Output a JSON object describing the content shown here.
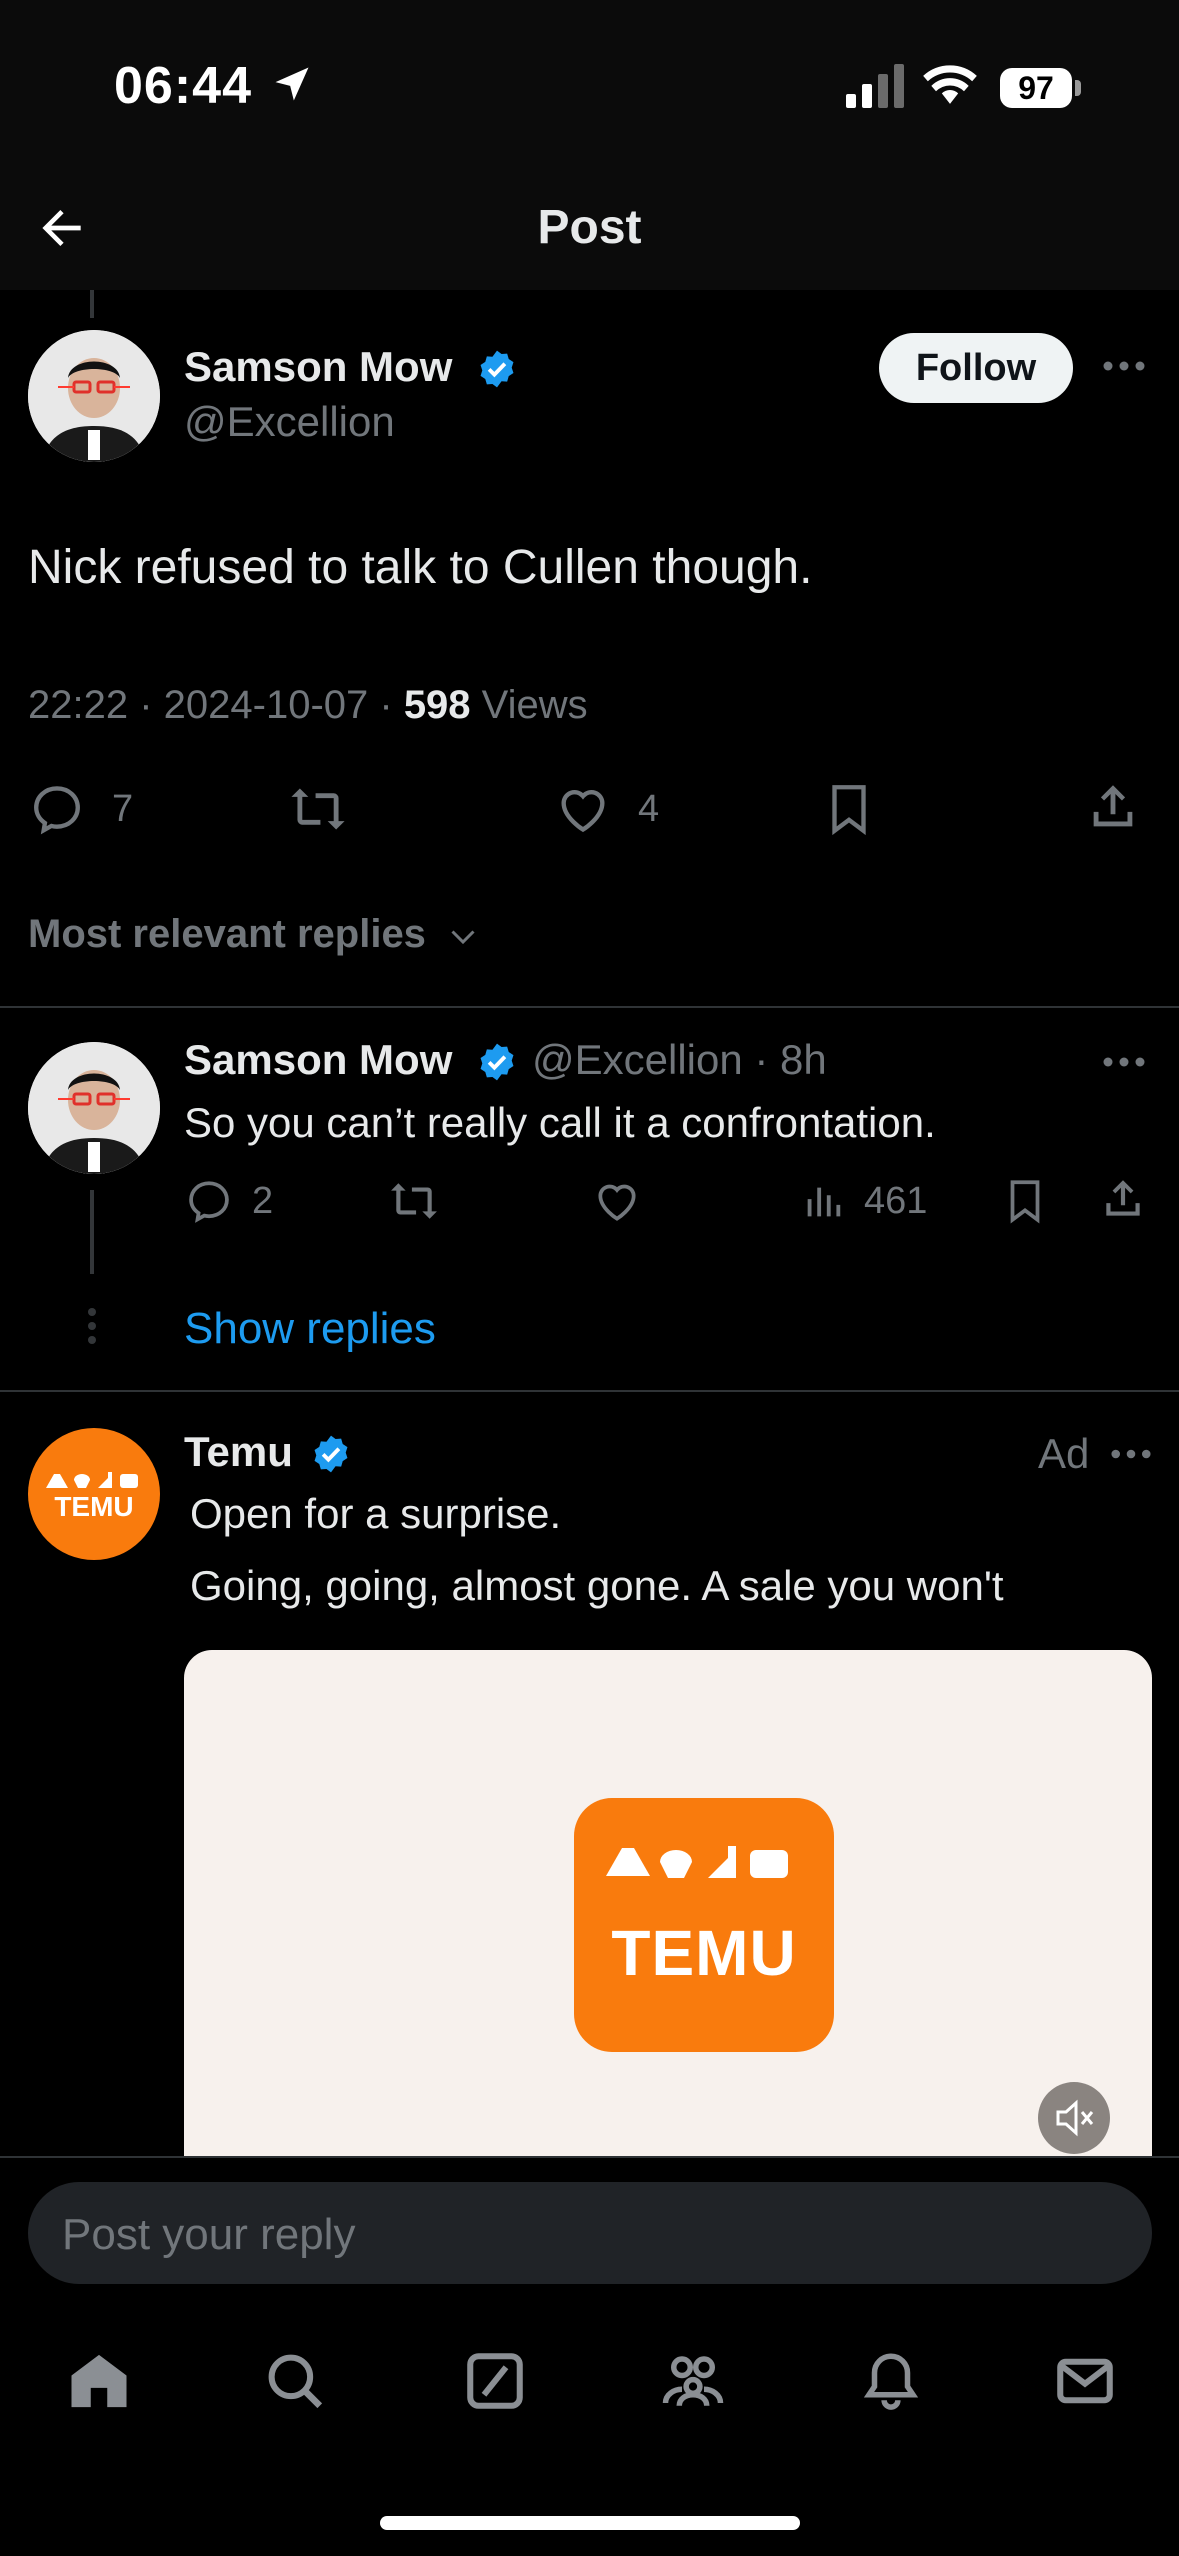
{
  "status_bar": {
    "time": "06:44",
    "battery": "97"
  },
  "header": {
    "title": "Post"
  },
  "main_post": {
    "author_name": "Samson Mow",
    "author_handle": "@Excellion",
    "follow_label": "Follow",
    "text": "Nick refused to talk to Cullen though.",
    "timestamp": "22:22 · 2024-10-07 · ",
    "views_count": "598",
    "views_label": " Views",
    "replies": "7",
    "likes": "4"
  },
  "sort": {
    "label": "Most relevant replies"
  },
  "reply": {
    "author_name": "Samson Mow",
    "handle_time": "@Excellion · 8h",
    "text": "So you can’t really call it a confrontation.",
    "replies": "2",
    "views": "461",
    "show_replies": "Show replies"
  },
  "ad": {
    "advertiser": "Temu",
    "ad_label": "Ad",
    "line1": "Open for a surprise.",
    "line2": "Going, going, almost gone. A sale you won't",
    "logo_text": "TEMU"
  },
  "composer": {
    "placeholder": "Post your reply"
  },
  "tabbar": [
    "home-icon",
    "search-icon",
    "grok-icon",
    "communities-icon",
    "notifications-icon",
    "messages-icon"
  ],
  "colors": {
    "accent": "#1d9bf0",
    "temu": "#f97b0d",
    "background": "#000000"
  }
}
